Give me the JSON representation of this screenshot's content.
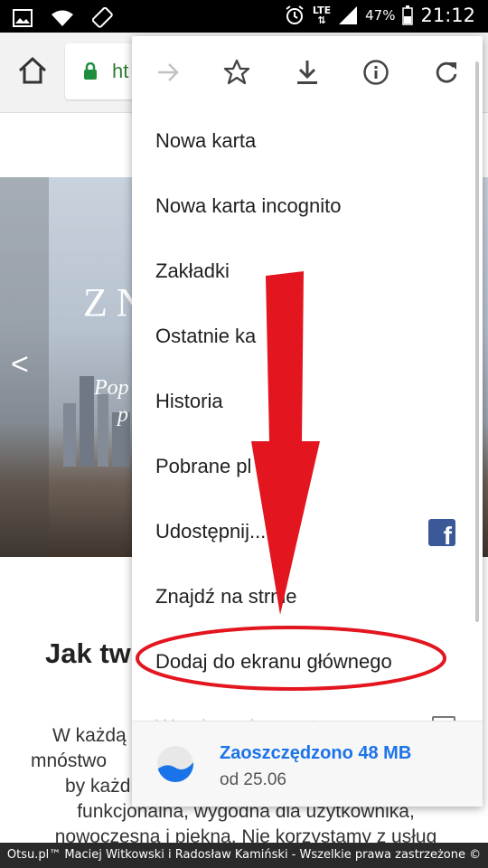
{
  "status_bar": {
    "lte": "LTE",
    "battery": "47%",
    "time": "21:12"
  },
  "browser": {
    "url_partial": "ht"
  },
  "page": {
    "hero_title": "ZN",
    "hero_subtitle_line1": "Pop",
    "hero_subtitle_line2": "p",
    "prev_arrow": "<",
    "heading_partial": "Jak tw",
    "paragraph_lines": [
      "W każdą",
      "mnóstwo",
      "by każd",
      "funkcjonalna, wygodna dla użytkownika,",
      "nowoczesna i piękna. Nie korzystamy z usług"
    ]
  },
  "menu": {
    "top_icons": [
      "forward-icon",
      "star-icon",
      "download-icon",
      "info-icon",
      "refresh-icon"
    ],
    "items": [
      {
        "label": "Nowa karta"
      },
      {
        "label": "Nowa karta incognito"
      },
      {
        "label": "Zakładki"
      },
      {
        "label": "Ostatnie ka"
      },
      {
        "label": "Historia"
      },
      {
        "label": "Pobrane pl"
      },
      {
        "label": "Udostępnij..."
      },
      {
        "label": "Znajdź na strnie"
      },
      {
        "label": "Dodaj do ekranu głównego"
      },
      {
        "label": "Wersja na komputer"
      }
    ],
    "savings_title": "Zaoszczędzono 48 MB",
    "savings_subtitle": "od 25.06"
  },
  "footer": {
    "text": "Otsu.pl™ Maciej Witkowski i Radosław Kamiński - Wszelkie prawa zastrzeżone ©"
  },
  "colors": {
    "accent_blue": "#1a73e8",
    "lock_green": "#1e8e3e",
    "annotation_red": "#e3151f",
    "facebook_blue": "#3b5998"
  }
}
